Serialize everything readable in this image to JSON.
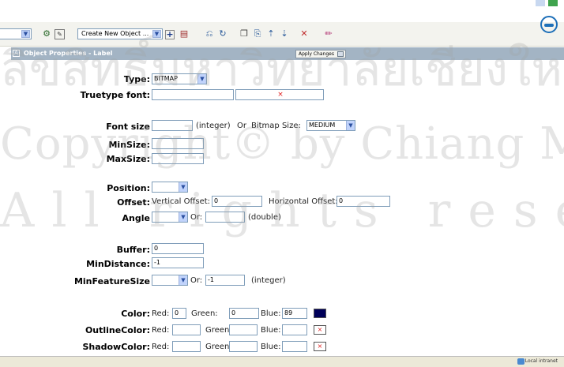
{
  "toolbar": {
    "create_select_value": "Create New Object ...",
    "icons": [
      "connect-icon",
      "edit-icon",
      "plus-icon",
      "layer-icon",
      "undo-icon",
      "redo-icon",
      "copy-icon",
      "paste-icon",
      "move-up-icon",
      "move-down-icon",
      "delete-icon",
      "pencil-icon"
    ]
  },
  "panel": {
    "title": "Object Properties - Label",
    "apply_label": "Apply Changes"
  },
  "form": {
    "type": {
      "label": "Type:",
      "value": "BITMAP"
    },
    "truetype_font": {
      "label": "Truetype font:",
      "value": "",
      "color_mark": "×"
    },
    "font_size": {
      "label": "Font size",
      "value": "",
      "integer_hint": "(integer)",
      "or": "Or",
      "bitmap_size_label": "Bitmap Size:",
      "bitmap_size_value": "MEDIUM"
    },
    "min_size": {
      "label": "MinSize:",
      "value": ""
    },
    "max_size": {
      "label": "MaxSize:",
      "value": ""
    },
    "position": {
      "label": "Position:",
      "value": ""
    },
    "offset": {
      "label": "Offset:",
      "vertical_label": "Vertical Offset:",
      "vertical_value": "0",
      "horizontal_label": "Horizontal Offset:",
      "horizontal_value": "0"
    },
    "angle": {
      "label": "Angle",
      "value": "",
      "or": "Or:",
      "double_hint": "(double)"
    },
    "buffer": {
      "label": "Buffer:",
      "value": "0"
    },
    "min_distance": {
      "label": "MinDistance:",
      "value": "-1"
    },
    "min_feature_size": {
      "label": "MinFeatureSize",
      "value": "",
      "or": "Or:",
      "or_value": "-1",
      "integer_hint": "(integer)"
    },
    "color": {
      "label": "Color:",
      "red_label": "Red:",
      "red_value": "0",
      "green_label": "Green:",
      "green_value": "0",
      "blue_label": "Blue:",
      "blue_value": "89",
      "swatch": "#000059"
    },
    "outline_color": {
      "label": "OutlineColor:",
      "red_label": "Red:",
      "red_value": "",
      "green_label": "Green:",
      "green_value": "",
      "blue_label": "Blue:",
      "blue_value": "",
      "mark": "×"
    },
    "shadow_color": {
      "label": "ShadowColor:",
      "red_label": "Red:",
      "red_value": "",
      "green_label": "Green:",
      "green_value": "",
      "blue_label": "Blue:",
      "blue_value": "",
      "mark": "×"
    }
  },
  "statusbar": {
    "zone": "Local intranet"
  },
  "watermark": {
    "line1": "ลิขสิทธิ์มหาวิทยาลัยเชียงใหม่",
    "line2": "Copyright© by Chiang Mai University",
    "line3": "All rights reserved"
  }
}
